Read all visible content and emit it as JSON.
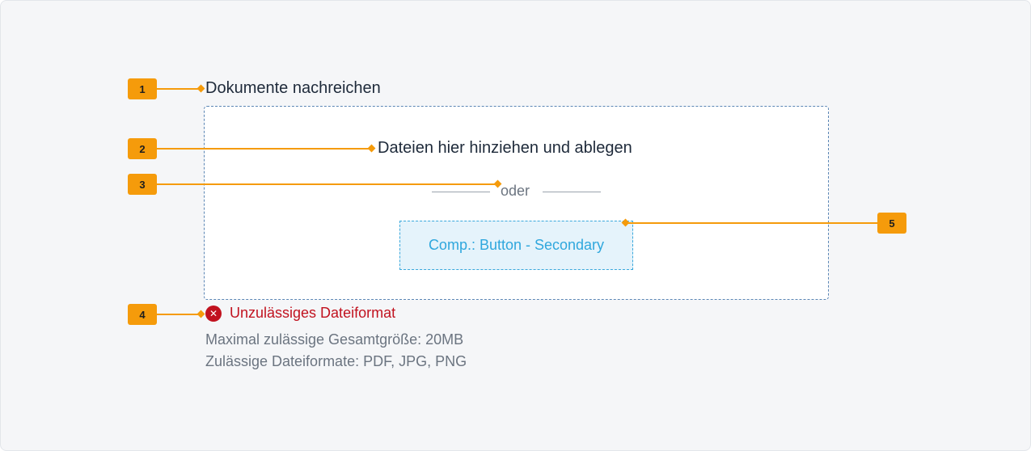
{
  "upload": {
    "title": "Dokumente nachreichen",
    "drop_text": "Dateien hier hinziehen und ablegen",
    "or_text": "oder",
    "button_label": "Comp.: Button - Secondary",
    "error_text": "Unzulässiges Dateiformat",
    "error_icon_glyph": "✕",
    "max_size_text": "Maximal zulässige Gesamtgröße: 20MB",
    "formats_text": "Zulässige Dateiformate: PDF, JPG, PNG"
  },
  "annotations": [
    {
      "number": "1"
    },
    {
      "number": "2"
    },
    {
      "number": "3"
    },
    {
      "number": "4"
    },
    {
      "number": "5"
    }
  ],
  "colors": {
    "annotation": "#f59b0b",
    "error": "#c1121f",
    "button_text": "#2fa7dd",
    "dropzone_border": "#5b86b5"
  },
  "icons": {
    "error": "error-circle-icon"
  }
}
